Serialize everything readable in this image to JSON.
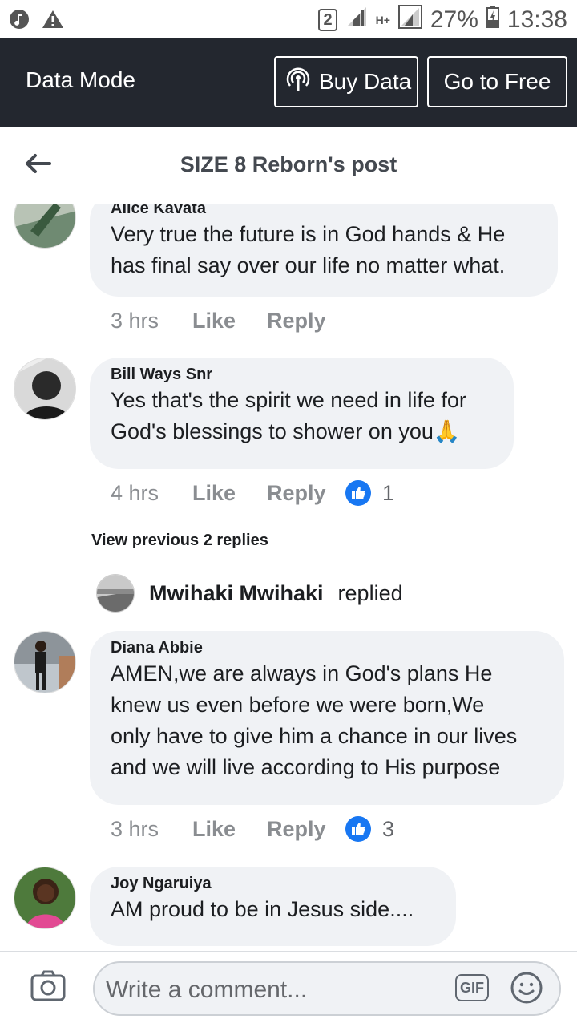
{
  "status_bar": {
    "sim_badge": "2",
    "network_type": "H+",
    "battery": "27%",
    "time": "13:38"
  },
  "data_mode": {
    "label": "Data Mode",
    "buy_label": "Buy Data",
    "free_label": "Go to Free"
  },
  "header": {
    "title": "SIZE 8 Reborn's post"
  },
  "comments": [
    {
      "author": "Alice Kavata",
      "lines": [
        "Very true the future is in God hands & He",
        "has final say over our life no matter what."
      ],
      "time": "3 hrs",
      "like_label": "Like",
      "reply_label": "Reply"
    },
    {
      "author": "Bill Ways Snr",
      "lines": [
        "Yes that's the spirit we need in life for",
        "God's blessings to shower on you"
      ],
      "emoji": "🙏",
      "time": "4 hrs",
      "like_label": "Like",
      "reply_label": "Reply",
      "reactions": "1"
    },
    {
      "author": "Diana Abbie",
      "lines": [
        "AMEN,we are always in God's plans He",
        "knew us even before we were born,We",
        "only have to give him a chance in our lives",
        "and we will live according to His purpose"
      ],
      "time": "3 hrs",
      "like_label": "Like",
      "reply_label": "Reply",
      "reactions": "3"
    },
    {
      "author": "Joy Ngaruiya",
      "lines": [
        "AM proud to be in Jesus side...."
      ]
    }
  ],
  "replies_thread": {
    "view_previous": "View previous 2 replies",
    "replier": "Mwihaki Mwihaki",
    "replied_verb": "replied"
  },
  "composer": {
    "placeholder": "Write a comment...",
    "gif_label": "GIF"
  },
  "colors": {
    "data_bar": "#23272f",
    "bubble": "#f0f2f5",
    "like_blue": "#1877f2"
  }
}
